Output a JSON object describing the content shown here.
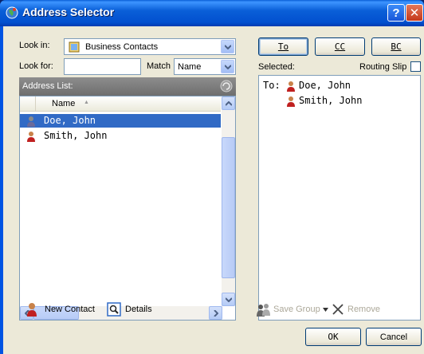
{
  "window": {
    "title": "Address Selector"
  },
  "look_in": {
    "label": "Look in:",
    "value": "Business Contacts"
  },
  "look_for": {
    "label": "Look for:",
    "value": ""
  },
  "match": {
    "label": "Match",
    "value": "Name"
  },
  "address_list": {
    "header": "Address List:",
    "column": "Name",
    "sort_indicator": "▲",
    "rows": [
      {
        "name": "Doe, John",
        "selected": true
      },
      {
        "name": "Smith, John",
        "selected": false
      }
    ]
  },
  "recipient_buttons": {
    "to": "To",
    "cc": "CC",
    "bc": "BC"
  },
  "selected": {
    "label": "Selected:",
    "routing_slip": "Routing Slip",
    "to_prefix": "To:",
    "entries": [
      "Doe, John",
      "Smith, John"
    ]
  },
  "bottom_left": {
    "new_contact": "New Contact",
    "details": "Details"
  },
  "bottom_right": {
    "save_group": "Save Group",
    "remove": "Remove",
    "ok": "OK",
    "cancel": "Cancel"
  },
  "icons": {
    "title": "globe-icon",
    "folder": "address-book-icon",
    "contact": "contact-person-icon",
    "details": "details-icon",
    "refresh": "refresh-icon",
    "save_group": "group-icon",
    "remove": "remove-x-icon"
  },
  "colors": {
    "title_bar": "#0054e3",
    "selection": "#316ac5",
    "dialog_bg": "#ece9d8"
  }
}
